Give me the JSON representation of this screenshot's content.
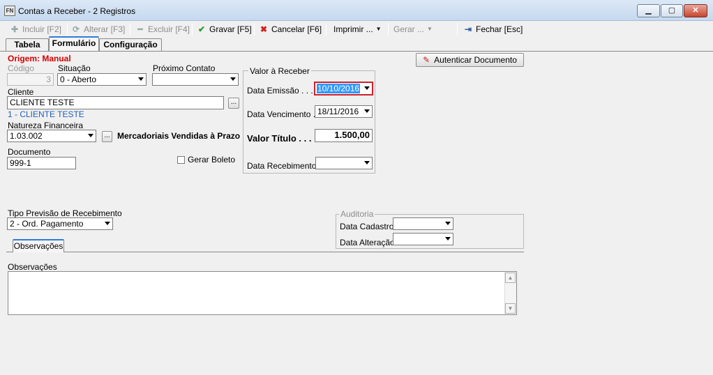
{
  "window": {
    "app_icon_text": "FN",
    "title": "Contas a Receber - 2 Registros",
    "min_label": "▁",
    "max_label": "▢",
    "close_label": "✕"
  },
  "toolbar": {
    "incluir": "Incluir [F2]",
    "alterar": "Alterar [F3]",
    "excluir": "Excluir [F4]",
    "gravar": "Gravar [F5]",
    "cancelar": "Cancelar [F6]",
    "imprimir": "Imprimir ...",
    "gerar": "Gerar ...",
    "fechar": "Fechar [Esc]"
  },
  "tabs": {
    "tabela": "Tabela",
    "formulario": "Formulário",
    "configuracao": "Configuração"
  },
  "form": {
    "origem": "Origem: Manual",
    "codigo_label": "Código",
    "codigo_value": "3",
    "situacao_label": "Situação",
    "situacao_value": "0 - Aberto",
    "proximo_contato_label": "Próximo Contato",
    "proximo_contato_value": "",
    "cliente_label": "Cliente",
    "cliente_value": "CLIENTE TESTE",
    "cliente_desc": "1 - CLIENTE TESTE",
    "ellipsis": "...",
    "natureza_label": "Natureza Financeira",
    "natureza_value": "1.03.002",
    "natureza_desc": "Mercadoriais Vendidas à Prazo",
    "documento_label": "Documento",
    "documento_value": "999-1",
    "gerar_boleto_label": "Gerar Boleto",
    "autenticar_label": "Autenticar Documento",
    "valor_group_title": "Valor à Receber",
    "data_emissao_label": "Data Emissão . . . . .",
    "data_emissao_value": "10/10/2016",
    "data_vencimento_label": "Data Vencimento . .",
    "data_vencimento_value": "18/11/2016",
    "valor_titulo_label": "Valor Título . . . .",
    "valor_titulo_value": "1.500,00",
    "data_recebimento_label": "Data Recebimento",
    "data_recebimento_value": "",
    "tipo_previsao_label": "Tipo Previsão de Recebimento",
    "tipo_previsao_value": "2 - Ord. Pagamento",
    "auditoria_title": "Auditoria",
    "data_cadastro_label": "Data Cadastro .",
    "data_cadastro_value": "",
    "data_alteracao_label": "Data Alteração .",
    "data_alteracao_value": "",
    "obs_tab_label": "Observações",
    "obs_label": "Observações",
    "obs_value": ""
  },
  "colors": {
    "origem": "#d40000",
    "cliente_desc": "#1f5fbf",
    "selection": "#3399ff",
    "focus_border": "#d0202a"
  }
}
